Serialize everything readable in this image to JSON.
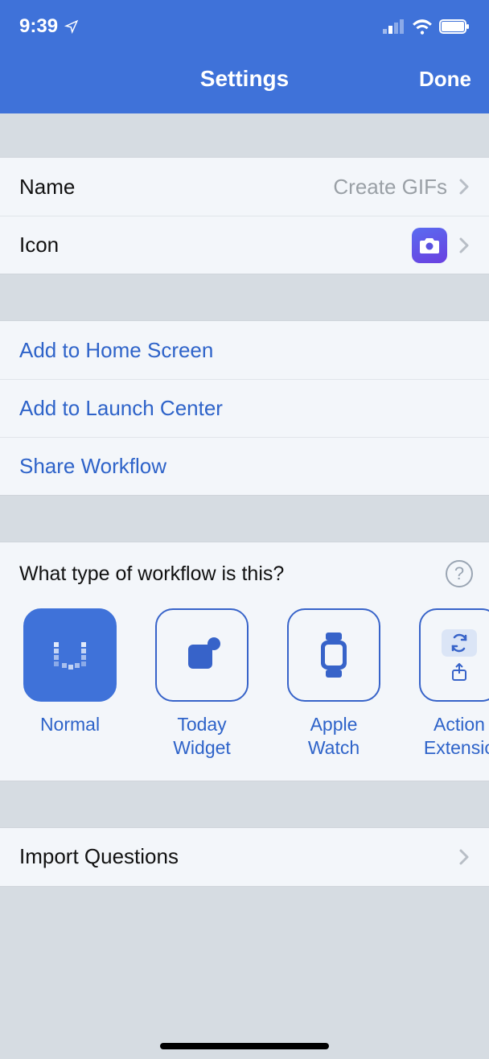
{
  "statusbar": {
    "time": "9:39"
  },
  "nav": {
    "title": "Settings",
    "done": "Done"
  },
  "info": {
    "name_label": "Name",
    "name_value": "Create GIFs",
    "icon_label": "Icon"
  },
  "actions": {
    "home_screen": "Add to Home Screen",
    "launch_center": "Add to Launch Center",
    "share": "Share Workflow"
  },
  "type": {
    "question": "What type of workflow is this?",
    "options": [
      "Normal",
      "Today\nWidget",
      "Apple\nWatch",
      "Action\nExtensio"
    ],
    "selected": 0
  },
  "import": {
    "label": "Import Questions"
  }
}
